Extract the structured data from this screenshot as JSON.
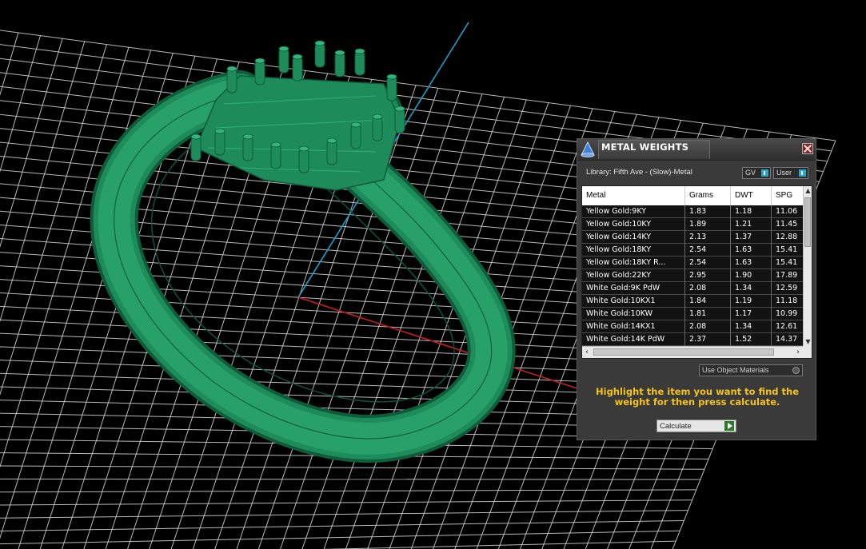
{
  "viewport": {
    "colors": {
      "background": "#000000",
      "grid": "#d8d8d8",
      "axis_x": "#c81e1e",
      "axis_y": "#1aa3c8",
      "model": "#1e8c5a"
    },
    "model_icon": "ring-wireframe"
  },
  "panel": {
    "title": "METAL WEIGHTS",
    "library_label": "Library: Fifth Ave - (Slow)-Metal",
    "toggles": {
      "gv": "GV",
      "user": "User"
    },
    "columns": [
      "Metal",
      "Grams",
      "DWT",
      "SPG"
    ],
    "rows": [
      [
        "Yellow Gold:9KY",
        "1.83",
        "1.18",
        "11.06"
      ],
      [
        "Yellow Gold:10KY",
        "1.89",
        "1.21",
        "11.45"
      ],
      [
        "Yellow Gold:14KY",
        "2.13",
        "1.37",
        "12.88"
      ],
      [
        "Yellow Gold:18KY",
        "2.54",
        "1.63",
        "15.41"
      ],
      [
        "Yellow Gold:18KY R...",
        "2.54",
        "1.63",
        "15.41"
      ],
      [
        "Yellow Gold:22KY",
        "2.95",
        "1.90",
        "17.89"
      ],
      [
        "White Gold:9K PdW",
        "2.08",
        "1.34",
        "12.59"
      ],
      [
        "White Gold:10KX1",
        "1.84",
        "1.19",
        "11.18"
      ],
      [
        "White Gold:10KW",
        "1.81",
        "1.17",
        "10.99"
      ],
      [
        "White Gold:14KX1",
        "2.08",
        "1.34",
        "12.61"
      ],
      [
        "White Gold:14K PdW",
        "2.37",
        "1.52",
        "14.37"
      ]
    ],
    "use_object_materials": "Use Object Materials",
    "hint": "Highlight the item you want to find the weight for then press calculate.",
    "calculate_label": "Calculate",
    "colors": {
      "hint": "#f6c31c",
      "panel_bg": "#3a3a3a",
      "row_bg": "#121212"
    }
  }
}
